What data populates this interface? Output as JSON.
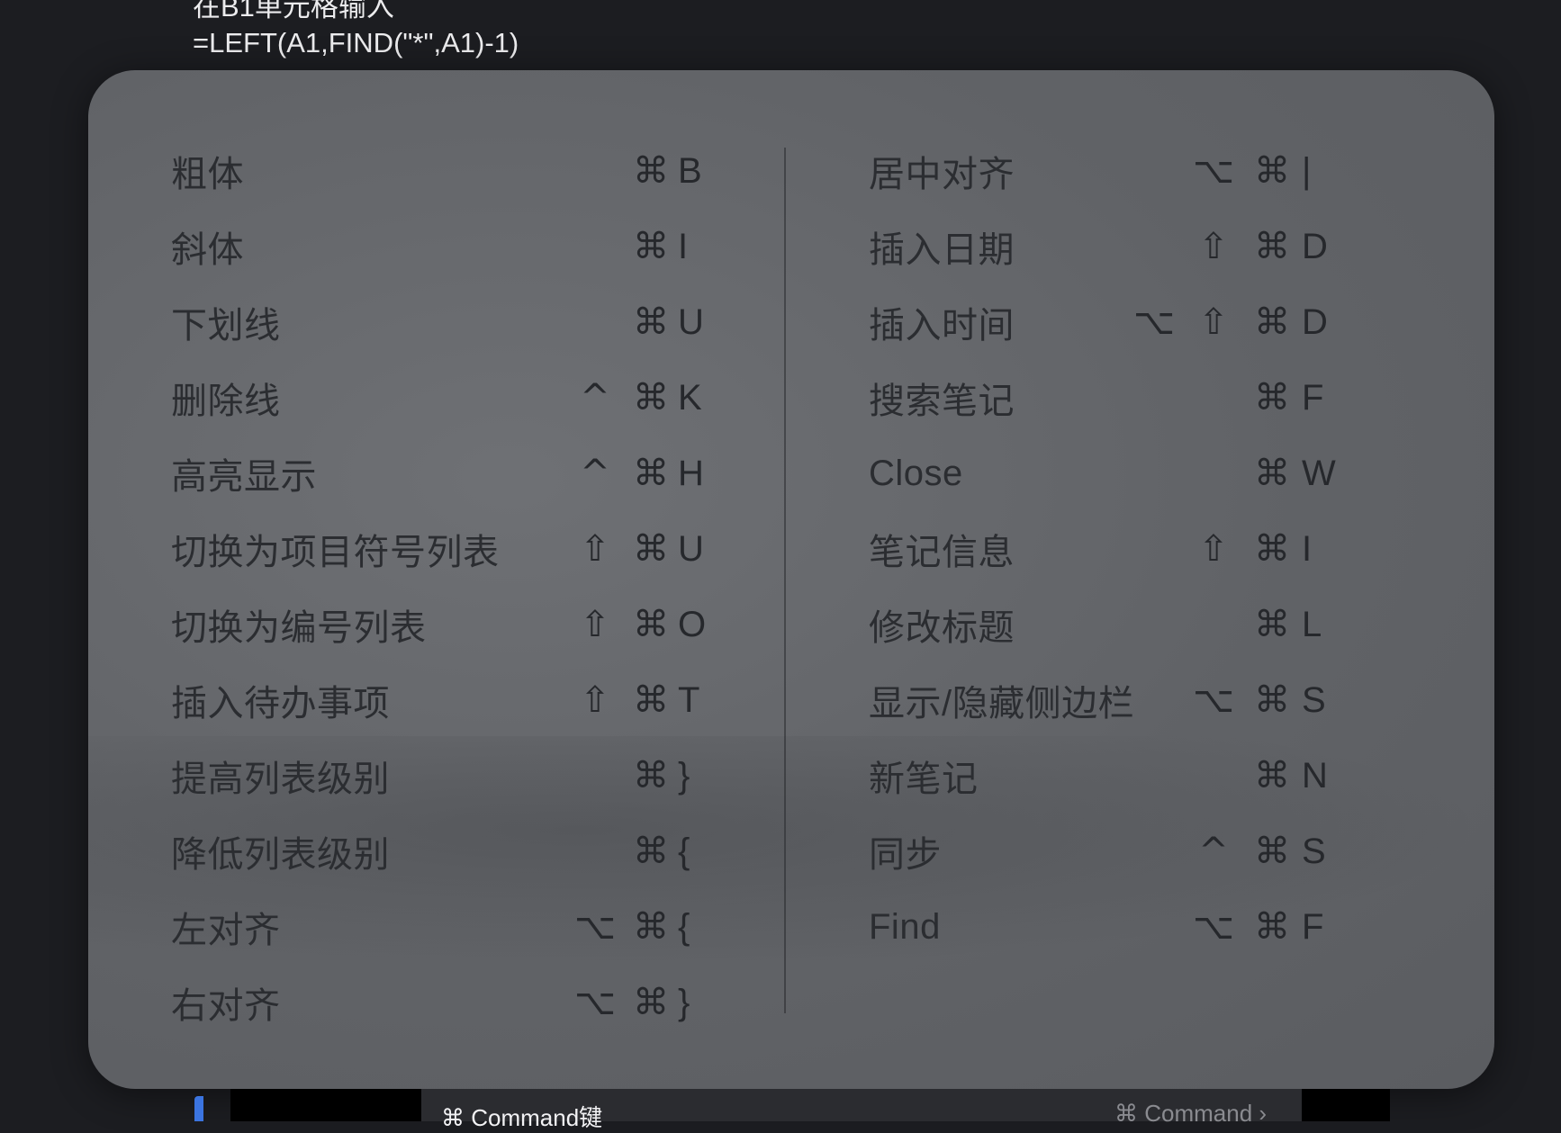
{
  "background": {
    "line1": "在B1单元格输入",
    "line2": "=LEFT(A1,FIND(\"*\",A1)-1)"
  },
  "shortcuts": {
    "left": [
      {
        "label": "粗体",
        "keys": [
          "⌘",
          "B"
        ]
      },
      {
        "label": "斜体",
        "keys": [
          "⌘",
          "I"
        ]
      },
      {
        "label": "下划线",
        "keys": [
          "⌘",
          "U"
        ]
      },
      {
        "label": "删除线",
        "keys": [
          "^",
          "⌘",
          "K"
        ]
      },
      {
        "label": "高亮显示",
        "keys": [
          "^",
          "⌘",
          "H"
        ]
      },
      {
        "label": "切换为项目符号列表",
        "keys": [
          "⇧",
          "⌘",
          "U"
        ]
      },
      {
        "label": "切换为编号列表",
        "keys": [
          "⇧",
          "⌘",
          "O"
        ]
      },
      {
        "label": "插入待办事项",
        "keys": [
          "⇧",
          "⌘",
          "T"
        ]
      },
      {
        "label": "提高列表级别",
        "keys": [
          "⌘",
          "}"
        ]
      },
      {
        "label": "降低列表级别",
        "keys": [
          "⌘",
          "{"
        ]
      },
      {
        "label": "左对齐",
        "keys": [
          "⌥",
          "⌘",
          "{"
        ]
      },
      {
        "label": "右对齐",
        "keys": [
          "⌥",
          "⌘",
          "}"
        ]
      }
    ],
    "right": [
      {
        "label": "居中对齐",
        "keys": [
          "⌥",
          "⌘",
          "|"
        ]
      },
      {
        "label": "插入日期",
        "keys": [
          "⇧",
          "⌘",
          "D"
        ]
      },
      {
        "label": "插入时间",
        "keys": [
          "⌥",
          "⇧",
          "⌘",
          "D"
        ]
      },
      {
        "label": "搜索笔记",
        "keys": [
          "⌘",
          "F"
        ]
      },
      {
        "label": "Close",
        "keys": [
          "⌘",
          "W"
        ]
      },
      {
        "label": "笔记信息",
        "keys": [
          "⇧",
          "⌘",
          "I"
        ]
      },
      {
        "label": "修改标题",
        "keys": [
          "⌘",
          "L"
        ]
      },
      {
        "label": "显示/隐藏侧边栏",
        "keys": [
          "⌥",
          "⌘",
          "S"
        ]
      },
      {
        "label": "新笔记",
        "keys": [
          "⌘",
          "N"
        ]
      },
      {
        "label": "同步",
        "keys": [
          "^",
          "⌘",
          "S"
        ]
      },
      {
        "label": "Find",
        "keys": [
          "⌥",
          "⌘",
          "F"
        ]
      }
    ]
  },
  "bottom": {
    "item_label": "⌘  Command键",
    "item_value": "⌘  Command  ›"
  }
}
